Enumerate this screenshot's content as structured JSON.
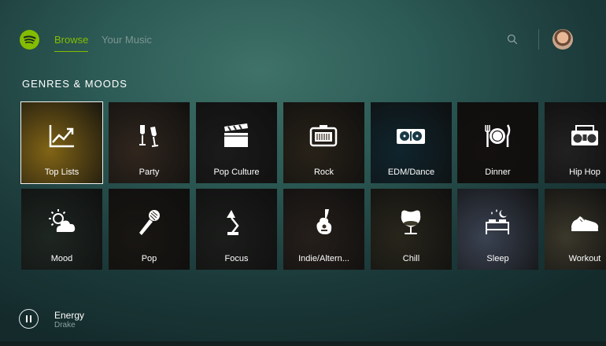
{
  "nav": {
    "browse": "Browse",
    "your_music": "Your Music"
  },
  "section": {
    "title": "GENRES & MOODS"
  },
  "tiles": [
    {
      "label": "Top Lists",
      "icon": "trending-up-icon",
      "color": "#c79a22"
    },
    {
      "label": "Party",
      "icon": "champagne-glasses-icon",
      "color": "#4b3b2e"
    },
    {
      "label": "Pop Culture",
      "icon": "clapperboard-icon",
      "color": "#2a2a2a"
    },
    {
      "label": "Rock",
      "icon": "amplifier-icon",
      "color": "#3d3426"
    },
    {
      "label": "EDM/Dance",
      "icon": "turntables-icon",
      "color": "#183946"
    },
    {
      "label": "Dinner",
      "icon": "plate-cutlery-icon",
      "color": "#1f1a17"
    },
    {
      "label": "Hip Hop",
      "icon": "boombox-icon",
      "color": "#333333"
    },
    {
      "label": "Mood",
      "icon": "sun-cloud-icon",
      "color": "#2f3c34"
    },
    {
      "label": "Pop",
      "icon": "microphone-icon",
      "color": "#27231d"
    },
    {
      "label": "Focus",
      "icon": "desk-lamp-icon",
      "color": "#2a2d2a"
    },
    {
      "label": "Indie/Altern...",
      "icon": "guitar-icon",
      "color": "#3a3029"
    },
    {
      "label": "Chill",
      "icon": "egg-chair-icon",
      "color": "#3d3a2a"
    },
    {
      "label": "Sleep",
      "icon": "bed-moon-icon",
      "color": "#5a667d"
    },
    {
      "label": "Workout",
      "icon": "sneaker-icon",
      "color": "#5a5642"
    }
  ],
  "player": {
    "title": "Energy",
    "artist": "Drake",
    "state": "playing"
  },
  "colors": {
    "accent": "#84bd00"
  }
}
